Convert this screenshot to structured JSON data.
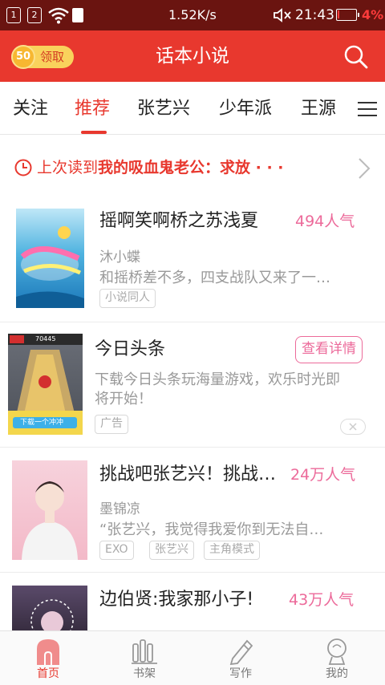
{
  "status_bar": {
    "sim1": "1",
    "sim2": "2",
    "net_speed": "1.52K/s",
    "time": "21:43",
    "battery_pct": "4%"
  },
  "header": {
    "coin_value": "50",
    "coin_label": "领取",
    "title": "话本小说"
  },
  "tabs": [
    {
      "label": "关注"
    },
    {
      "label": "推荐",
      "active": true
    },
    {
      "label": "张艺兴"
    },
    {
      "label": "少年派"
    },
    {
      "label": "王源"
    }
  ],
  "last_read": {
    "prefix": "上次读到",
    "title": "我的吸血鬼老公：求放 · · ·"
  },
  "items": [
    {
      "title": "摇啊笑啊桥之苏浅夏",
      "popularity": "494人气",
      "author": "沐小蝶",
      "desc": "和摇桥差不多，四支战队又来了一…",
      "tags": [
        "小说同人"
      ]
    },
    {
      "title": "今日头条",
      "button": "查看详情",
      "desc_line1": "下载今日头条玩海量游戏，欢乐时光即",
      "desc_line2": "将开始！",
      "tag": "广告",
      "cover_score": "70445",
      "cover_caption": "下载一个冲冲"
    },
    {
      "title": "挑战吧张艺兴！挑战…",
      "popularity": "24万人气",
      "author": "墨锦凉",
      "desc": "“张艺兴，我觉得我爱你到无法自…",
      "tags": [
        "EXO",
        "张艺兴",
        "主角模式"
      ]
    },
    {
      "title": "边伯贤:我家那小子!",
      "popularity": "43万人气"
    }
  ],
  "bottom_nav": [
    {
      "label": "首页",
      "icon": "home-arch-icon",
      "active": true
    },
    {
      "label": "书架",
      "icon": "bookshelf-icon"
    },
    {
      "label": "写作",
      "icon": "pencil-icon"
    },
    {
      "label": "我的",
      "icon": "profile-icon"
    }
  ],
  "colors": {
    "brand_red": "#e8382e",
    "status_bar": "#6a1410",
    "pink_accent": "#ec6a9a"
  }
}
